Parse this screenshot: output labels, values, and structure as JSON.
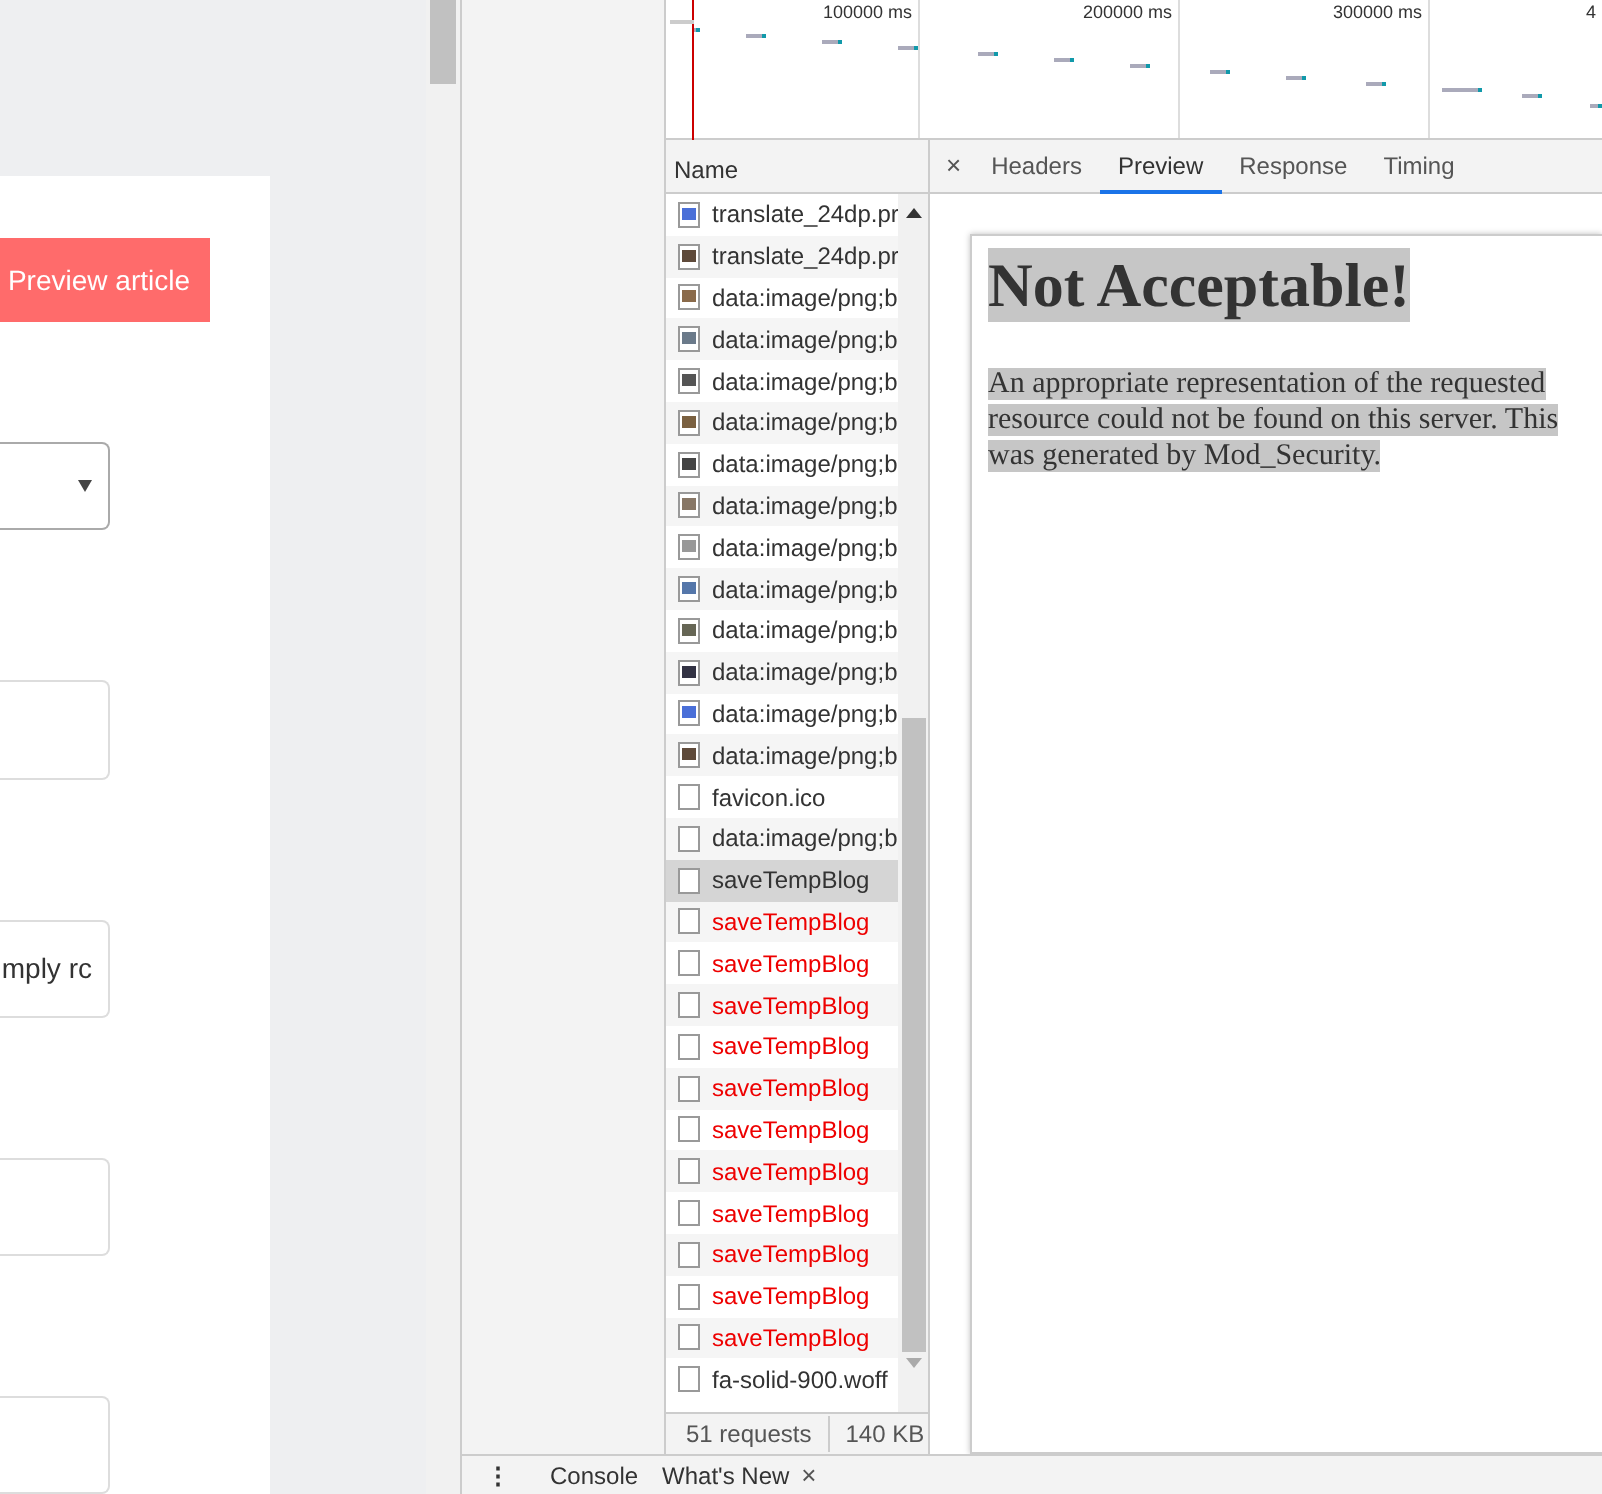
{
  "page": {
    "preview_button": "Preview article",
    "fields": [
      {
        "kind": "select"
      },
      {
        "kind": "text"
      },
      {
        "kind": "text",
        "value": "mply rc"
      },
      {
        "kind": "text"
      },
      {
        "kind": "text"
      }
    ]
  },
  "timeline": {
    "tick_labels": [
      "100000 ms",
      "200000 ms",
      "300000 ms",
      "4"
    ]
  },
  "requests": {
    "column": "Name",
    "rows": [
      {
        "name": "translate_24dp.pr",
        "kind": "image",
        "failed": false,
        "selected": false
      },
      {
        "name": "translate_24dp.pr",
        "kind": "image",
        "failed": false,
        "selected": false
      },
      {
        "name": "data:image/png;b",
        "kind": "image",
        "failed": false,
        "selected": false
      },
      {
        "name": "data:image/png;b",
        "kind": "image",
        "failed": false,
        "selected": false
      },
      {
        "name": "data:image/png;b",
        "kind": "image",
        "failed": false,
        "selected": false
      },
      {
        "name": "data:image/png;b",
        "kind": "image",
        "failed": false,
        "selected": false
      },
      {
        "name": "data:image/png;b",
        "kind": "image",
        "failed": false,
        "selected": false
      },
      {
        "name": "data:image/png;b",
        "kind": "image",
        "failed": false,
        "selected": false
      },
      {
        "name": "data:image/png;b",
        "kind": "image",
        "failed": false,
        "selected": false
      },
      {
        "name": "data:image/png;b",
        "kind": "image",
        "failed": false,
        "selected": false
      },
      {
        "name": "data:image/png;b",
        "kind": "image",
        "failed": false,
        "selected": false
      },
      {
        "name": "data:image/png;b",
        "kind": "image",
        "failed": false,
        "selected": false
      },
      {
        "name": "data:image/png;b",
        "kind": "image",
        "failed": false,
        "selected": false
      },
      {
        "name": "data:image/png;b",
        "kind": "image",
        "failed": false,
        "selected": false
      },
      {
        "name": "favicon.ico",
        "kind": "file",
        "failed": false,
        "selected": false
      },
      {
        "name": "data:image/png;b",
        "kind": "file",
        "failed": false,
        "selected": false
      },
      {
        "name": "saveTempBlog",
        "kind": "file",
        "failed": false,
        "selected": true
      },
      {
        "name": "saveTempBlog",
        "kind": "file",
        "failed": true,
        "selected": false
      },
      {
        "name": "saveTempBlog",
        "kind": "file",
        "failed": true,
        "selected": false
      },
      {
        "name": "saveTempBlog",
        "kind": "file",
        "failed": true,
        "selected": false
      },
      {
        "name": "saveTempBlog",
        "kind": "file",
        "failed": true,
        "selected": false
      },
      {
        "name": "saveTempBlog",
        "kind": "file",
        "failed": true,
        "selected": false
      },
      {
        "name": "saveTempBlog",
        "kind": "file",
        "failed": true,
        "selected": false
      },
      {
        "name": "saveTempBlog",
        "kind": "file",
        "failed": true,
        "selected": false
      },
      {
        "name": "saveTempBlog",
        "kind": "file",
        "failed": true,
        "selected": false
      },
      {
        "name": "saveTempBlog",
        "kind": "file",
        "failed": true,
        "selected": false
      },
      {
        "name": "saveTempBlog",
        "kind": "file",
        "failed": true,
        "selected": false
      },
      {
        "name": "saveTempBlog",
        "kind": "file",
        "failed": true,
        "selected": false
      },
      {
        "name": "fa-solid-900.woff",
        "kind": "file",
        "failed": false,
        "selected": false
      }
    ]
  },
  "detail": {
    "close_glyph": "×",
    "tabs": [
      {
        "label": "Headers",
        "selected": false
      },
      {
        "label": "Preview",
        "selected": true
      },
      {
        "label": "Response",
        "selected": false
      },
      {
        "label": "Timing",
        "selected": false
      }
    ],
    "preview": {
      "heading": "Not Acceptable!",
      "text": "An appropriate representation of the requested resource could not be found on this server. This was generated by Mod_Security."
    }
  },
  "summary": {
    "requests": "51 requests",
    "size": "140 KB"
  },
  "drawer": {
    "menu_glyph": "⋮",
    "tabs": [
      {
        "label": "Console"
      },
      {
        "label": "What's New",
        "close": "×"
      }
    ]
  }
}
